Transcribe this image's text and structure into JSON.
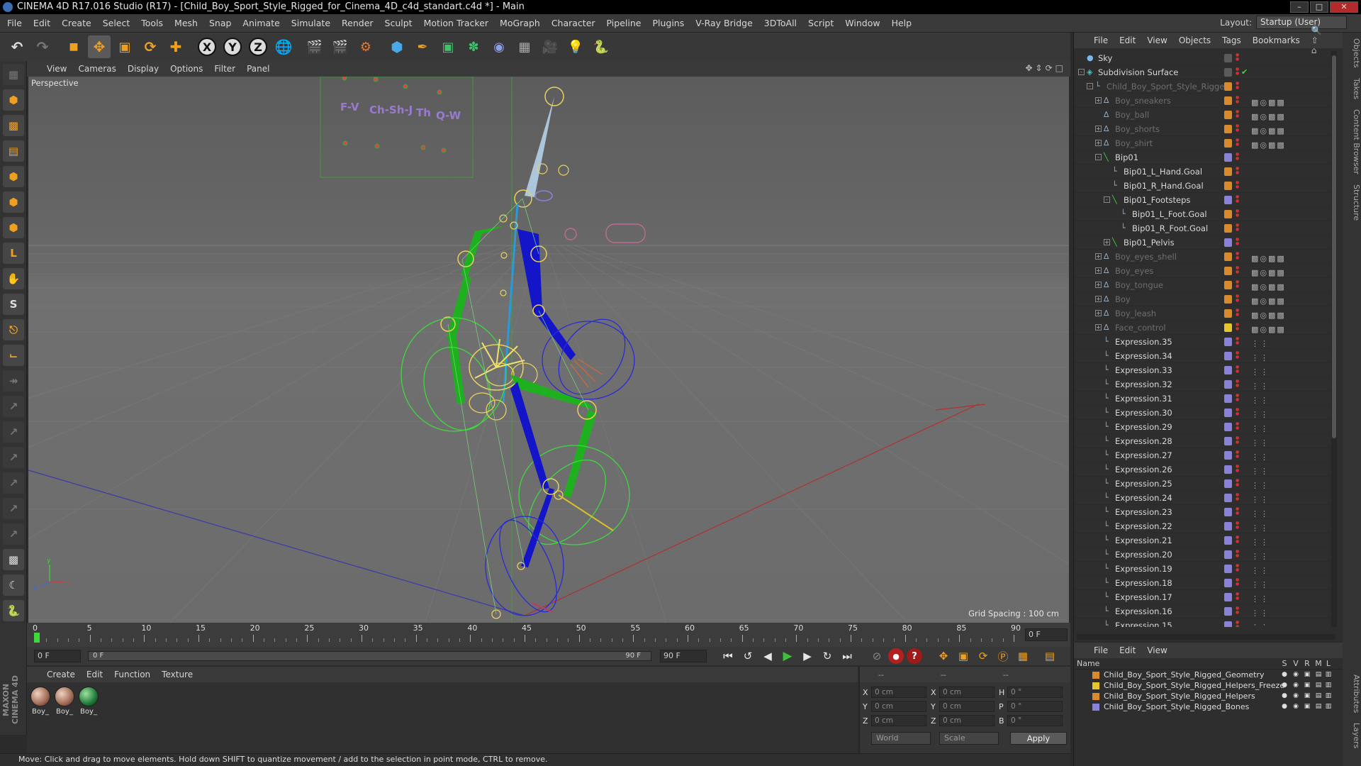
{
  "window": {
    "title": "CINEMA 4D R17.016 Studio (R17) - [Child_Boy_Sport_Style_Rigged_for_Cinema_4D_c4d_standart.c4d *] - Main"
  },
  "menubar": {
    "items": [
      "File",
      "Edit",
      "Create",
      "Select",
      "Tools",
      "Mesh",
      "Snap",
      "Animate",
      "Simulate",
      "Render",
      "Sculpt",
      "Motion Tracker",
      "MoGraph",
      "Character",
      "Pipeline",
      "Plugins",
      "V-Ray Bridge",
      "3DToAll",
      "Script",
      "Window",
      "Help"
    ],
    "layout_label": "Layout:",
    "layout_value": "Startup (User)"
  },
  "viewport": {
    "menu": [
      "View",
      "Cameras",
      "Display",
      "Options",
      "Filter",
      "Panel"
    ],
    "label": "Perspective",
    "grid_spacing": "Grid Spacing : 100 cm",
    "overlay_labels": [
      "F-V",
      "Ch-Sh-J",
      "Th",
      "Q-W"
    ]
  },
  "timeline": {
    "ticks": [
      "0",
      "5",
      "10",
      "15",
      "20",
      "25",
      "30",
      "35",
      "40",
      "45",
      "50",
      "55",
      "60",
      "65",
      "70",
      "75",
      "80",
      "85",
      "90"
    ],
    "frame_end": "0 F"
  },
  "transport": {
    "start": "0 F",
    "range_left": "0 F",
    "range_right": "90 F",
    "end": "90 F"
  },
  "materials": {
    "menu": [
      "Create",
      "Edit",
      "Function",
      "Texture"
    ],
    "items": [
      {
        "label": "Boy_"
      },
      {
        "label": "Boy_"
      },
      {
        "label": "Boy_"
      }
    ]
  },
  "coords": {
    "headers": [
      "--",
      "--",
      "--"
    ],
    "rows": [
      {
        "a": "X",
        "av": "0 cm",
        "b": "X",
        "bv": "0 cm",
        "c": "H",
        "cv": "0 °"
      },
      {
        "a": "Y",
        "av": "0 cm",
        "b": "Y",
        "bv": "0 cm",
        "c": "P",
        "cv": "0 °"
      },
      {
        "a": "Z",
        "av": "0 cm",
        "b": "Z",
        "bv": "0 cm",
        "c": "B",
        "cv": "0 °"
      }
    ],
    "space": "World",
    "mode": "Scale",
    "apply": "Apply"
  },
  "status": {
    "text": "Move: Click and drag to move elements. Hold down SHIFT to quantize movement / add to the selection in point mode, CTRL to remove."
  },
  "object_manager": {
    "menu": [
      "File",
      "Edit",
      "View",
      "Objects",
      "Tags",
      "Bookmarks"
    ],
    "objects": [
      {
        "name": "Sky",
        "indent": 0,
        "exp": "",
        "icon": "sky",
        "layer": "none",
        "grey": false
      },
      {
        "name": "Subdivision Surface",
        "indent": 0,
        "exp": "-",
        "icon": "subdiv",
        "layer": "none",
        "grey": false
      },
      {
        "name": "Child_Boy_Sport_Style_Rigged",
        "indent": 1,
        "exp": "-",
        "icon": "null",
        "layer": "orange",
        "grey": true
      },
      {
        "name": "Boy_sneakers",
        "indent": 2,
        "exp": "+",
        "icon": "poly",
        "layer": "orange",
        "grey": true
      },
      {
        "name": "Boy_ball",
        "indent": 2,
        "exp": "",
        "icon": "poly",
        "layer": "orange",
        "grey": true
      },
      {
        "name": "Boy_shorts",
        "indent": 2,
        "exp": "+",
        "icon": "poly",
        "layer": "orange",
        "grey": true
      },
      {
        "name": "Boy_shirt",
        "indent": 2,
        "exp": "+",
        "icon": "poly",
        "layer": "orange",
        "grey": true
      },
      {
        "name": "Bip01",
        "indent": 2,
        "exp": "-",
        "icon": "bone",
        "layer": "purple",
        "grey": false
      },
      {
        "name": "Bip01_L_Hand.Goal",
        "indent": 3,
        "exp": "",
        "icon": "null",
        "layer": "orange",
        "grey": false
      },
      {
        "name": "Bip01_R_Hand.Goal",
        "indent": 3,
        "exp": "",
        "icon": "null",
        "layer": "orange",
        "grey": false
      },
      {
        "name": "Bip01_Footsteps",
        "indent": 3,
        "exp": "-",
        "icon": "bone",
        "layer": "purple",
        "grey": false
      },
      {
        "name": "Bip01_L_Foot.Goal",
        "indent": 4,
        "exp": "",
        "icon": "null",
        "layer": "orange",
        "grey": false
      },
      {
        "name": "Bip01_R_Foot.Goal",
        "indent": 4,
        "exp": "",
        "icon": "null",
        "layer": "orange",
        "grey": false
      },
      {
        "name": "Bip01_Pelvis",
        "indent": 3,
        "exp": "+",
        "icon": "bone",
        "layer": "purple",
        "grey": false
      },
      {
        "name": "Boy_eyes_shell",
        "indent": 2,
        "exp": "+",
        "icon": "poly",
        "layer": "orange",
        "grey": true
      },
      {
        "name": "Boy_eyes",
        "indent": 2,
        "exp": "+",
        "icon": "poly",
        "layer": "orange",
        "grey": true
      },
      {
        "name": "Boy_tongue",
        "indent": 2,
        "exp": "+",
        "icon": "poly",
        "layer": "orange",
        "grey": true
      },
      {
        "name": "Boy",
        "indent": 2,
        "exp": "+",
        "icon": "poly",
        "layer": "orange",
        "grey": true
      },
      {
        "name": "Boy_leash",
        "indent": 2,
        "exp": "+",
        "icon": "poly",
        "layer": "orange",
        "grey": true
      },
      {
        "name": "Face_control",
        "indent": 2,
        "exp": "+",
        "icon": "poly",
        "layer": "yellow",
        "grey": true
      },
      {
        "name": "Expression.35",
        "indent": 2,
        "exp": "",
        "icon": "null",
        "layer": "purple",
        "grey": false
      },
      {
        "name": "Expression.34",
        "indent": 2,
        "exp": "",
        "icon": "null",
        "layer": "purple",
        "grey": false
      },
      {
        "name": "Expression.33",
        "indent": 2,
        "exp": "",
        "icon": "null",
        "layer": "purple",
        "grey": false
      },
      {
        "name": "Expression.32",
        "indent": 2,
        "exp": "",
        "icon": "null",
        "layer": "purple",
        "grey": false
      },
      {
        "name": "Expression.31",
        "indent": 2,
        "exp": "",
        "icon": "null",
        "layer": "purple",
        "grey": false
      },
      {
        "name": "Expression.30",
        "indent": 2,
        "exp": "",
        "icon": "null",
        "layer": "purple",
        "grey": false
      },
      {
        "name": "Expression.29",
        "indent": 2,
        "exp": "",
        "icon": "null",
        "layer": "purple",
        "grey": false
      },
      {
        "name": "Expression.28",
        "indent": 2,
        "exp": "",
        "icon": "null",
        "layer": "purple",
        "grey": false
      },
      {
        "name": "Expression.27",
        "indent": 2,
        "exp": "",
        "icon": "null",
        "layer": "purple",
        "grey": false
      },
      {
        "name": "Expression.26",
        "indent": 2,
        "exp": "",
        "icon": "null",
        "layer": "purple",
        "grey": false
      },
      {
        "name": "Expression.25",
        "indent": 2,
        "exp": "",
        "icon": "null",
        "layer": "purple",
        "grey": false
      },
      {
        "name": "Expression.24",
        "indent": 2,
        "exp": "",
        "icon": "null",
        "layer": "purple",
        "grey": false
      },
      {
        "name": "Expression.23",
        "indent": 2,
        "exp": "",
        "icon": "null",
        "layer": "purple",
        "grey": false
      },
      {
        "name": "Expression.22",
        "indent": 2,
        "exp": "",
        "icon": "null",
        "layer": "purple",
        "grey": false
      },
      {
        "name": "Expression.21",
        "indent": 2,
        "exp": "",
        "icon": "null",
        "layer": "purple",
        "grey": false
      },
      {
        "name": "Expression.20",
        "indent": 2,
        "exp": "",
        "icon": "null",
        "layer": "purple",
        "grey": false
      },
      {
        "name": "Expression.19",
        "indent": 2,
        "exp": "",
        "icon": "null",
        "layer": "purple",
        "grey": false
      },
      {
        "name": "Expression.18",
        "indent": 2,
        "exp": "",
        "icon": "null",
        "layer": "purple",
        "grey": false
      },
      {
        "name": "Expression.17",
        "indent": 2,
        "exp": "",
        "icon": "null",
        "layer": "purple",
        "grey": false
      },
      {
        "name": "Expression.16",
        "indent": 2,
        "exp": "",
        "icon": "null",
        "layer": "purple",
        "grey": false
      },
      {
        "name": "Expression.15",
        "indent": 2,
        "exp": "",
        "icon": "null",
        "layer": "purple",
        "grey": false
      }
    ]
  },
  "layer_manager": {
    "menu": [
      "File",
      "Edit",
      "View"
    ],
    "header_name": "Name",
    "header_cols": [
      "S",
      "V",
      "R",
      "M",
      "L"
    ],
    "layers": [
      {
        "name": "Child_Boy_Sport_Style_Rigged_Geometry",
        "color": "#d98a2a"
      },
      {
        "name": "Child_Boy_Sport_Style_Rigged_Helpers_Freeze",
        "color": "#e6c62a"
      },
      {
        "name": "Child_Boy_Sport_Style_Rigged_Helpers",
        "color": "#d98a2a"
      },
      {
        "name": "Child_Boy_Sport_Style_Rigged_Bones",
        "color": "#8a82d8"
      }
    ]
  },
  "right_tabs": [
    "Objects",
    "Takes",
    "Content Browser",
    "Structure",
    "Attributes",
    "Layers"
  ]
}
